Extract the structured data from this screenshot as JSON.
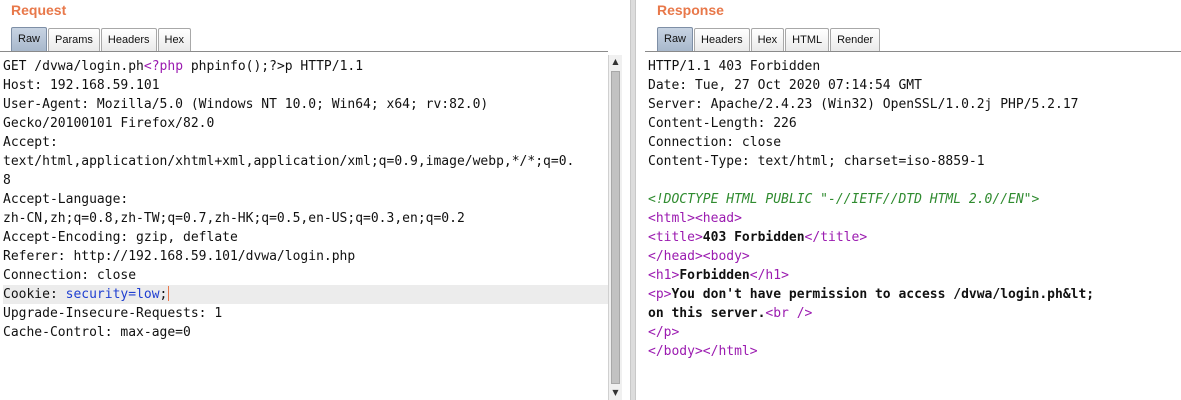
{
  "request": {
    "title": "Request",
    "tabs": [
      "Raw",
      "Params",
      "Headers",
      "Hex"
    ],
    "active_tab": "Raw",
    "lines": [
      {
        "segments": [
          {
            "t": "GET /dvwa/login.ph",
            "s": "plain"
          },
          {
            "t": "<?php",
            "s": "tag"
          },
          {
            "t": " phpinfo();?>p HTTP/1.1",
            "s": "plain"
          }
        ]
      },
      {
        "segments": [
          {
            "t": "Host: 192.168.59.101",
            "s": "plain"
          }
        ]
      },
      {
        "segments": [
          {
            "t": "User-Agent: Mozilla/5.0 (Windows NT 10.0; Win64; x64; rv:82.0)",
            "s": "plain"
          }
        ]
      },
      {
        "segments": [
          {
            "t": "Gecko/20100101 Firefox/82.0",
            "s": "plain"
          }
        ]
      },
      {
        "segments": [
          {
            "t": "Accept:",
            "s": "plain"
          }
        ]
      },
      {
        "segments": [
          {
            "t": "text/html,application/xhtml+xml,application/xml;q=0.9,image/webp,*/*;q=0.",
            "s": "plain"
          }
        ]
      },
      {
        "segments": [
          {
            "t": "8",
            "s": "plain"
          }
        ]
      },
      {
        "segments": [
          {
            "t": "Accept-Language:",
            "s": "plain"
          }
        ]
      },
      {
        "segments": [
          {
            "t": "zh-CN,zh;q=0.8,zh-TW;q=0.7,zh-HK;q=0.5,en-US;q=0.3,en;q=0.2",
            "s": "plain"
          }
        ]
      },
      {
        "segments": [
          {
            "t": "Accept-Encoding: gzip, deflate",
            "s": "plain"
          }
        ]
      },
      {
        "segments": [
          {
            "t": "Referer: http://192.168.59.101/dvwa/login.php",
            "s": "plain"
          }
        ]
      },
      {
        "segments": [
          {
            "t": "Connection: close",
            "s": "plain"
          }
        ]
      },
      {
        "segments": [
          {
            "t": "Cookie: ",
            "s": "plain"
          },
          {
            "t": "security=low",
            "s": "param"
          },
          {
            "t": ";",
            "s": "plain"
          }
        ],
        "highlight": true,
        "caret": true
      },
      {
        "segments": [
          {
            "t": "Upgrade-Insecure-Requests: 1",
            "s": "plain"
          }
        ]
      },
      {
        "segments": [
          {
            "t": "Cache-Control: max-age=0",
            "s": "plain"
          }
        ]
      }
    ]
  },
  "response": {
    "title": "Response",
    "tabs": [
      "Raw",
      "Headers",
      "Hex",
      "HTML",
      "Render"
    ],
    "active_tab": "Raw",
    "lines": [
      {
        "segments": [
          {
            "t": "HTTP/1.1 403 Forbidden",
            "s": "plain"
          }
        ]
      },
      {
        "segments": [
          {
            "t": "Date: Tue, 27 Oct 2020 07:14:54 GMT",
            "s": "plain"
          }
        ]
      },
      {
        "segments": [
          {
            "t": "Server: Apache/2.4.23 (Win32) OpenSSL/1.0.2j PHP/5.2.17",
            "s": "plain"
          }
        ]
      },
      {
        "segments": [
          {
            "t": "Content-Length: 226",
            "s": "plain"
          }
        ]
      },
      {
        "segments": [
          {
            "t": "Connection: close",
            "s": "plain"
          }
        ]
      },
      {
        "segments": [
          {
            "t": "Content-Type: text/html; charset=iso-8859-1",
            "s": "plain"
          }
        ]
      },
      {
        "segments": []
      },
      {
        "segments": [
          {
            "t": "<!DOCTYPE HTML PUBLIC \"-//IETF//DTD HTML 2.0//EN\">",
            "s": "comment"
          }
        ]
      },
      {
        "segments": [
          {
            "t": "<html>",
            "s": "tag"
          },
          {
            "t": "<head>",
            "s": "tag"
          }
        ]
      },
      {
        "segments": [
          {
            "t": "<title>",
            "s": "tag"
          },
          {
            "t": "403 Forbidden",
            "s": "bold"
          },
          {
            "t": "</title>",
            "s": "tag"
          }
        ]
      },
      {
        "segments": [
          {
            "t": "</head>",
            "s": "tag"
          },
          {
            "t": "<body>",
            "s": "tag"
          }
        ]
      },
      {
        "segments": [
          {
            "t": "<h1>",
            "s": "tag"
          },
          {
            "t": "Forbidden",
            "s": "bold"
          },
          {
            "t": "</h1>",
            "s": "tag"
          }
        ]
      },
      {
        "segments": [
          {
            "t": "<p>",
            "s": "tag"
          },
          {
            "t": "You don't have permission to access /dvwa/login.ph&lt;",
            "s": "bold"
          }
        ]
      },
      {
        "segments": [
          {
            "t": "on this server.",
            "s": "bold"
          },
          {
            "t": "<br />",
            "s": "tag"
          }
        ]
      },
      {
        "segments": [
          {
            "t": "</p>",
            "s": "tag"
          }
        ]
      },
      {
        "segments": [
          {
            "t": "</body>",
            "s": "tag"
          },
          {
            "t": "</html>",
            "s": "tag"
          }
        ]
      }
    ]
  },
  "icons": {
    "scroll_up": "▲",
    "scroll_down": "▼"
  },
  "colors": {
    "title": "#e8784a",
    "tag": "#9b1bb0",
    "comment": "#2f8b2f",
    "param": "#1f3fd1"
  }
}
